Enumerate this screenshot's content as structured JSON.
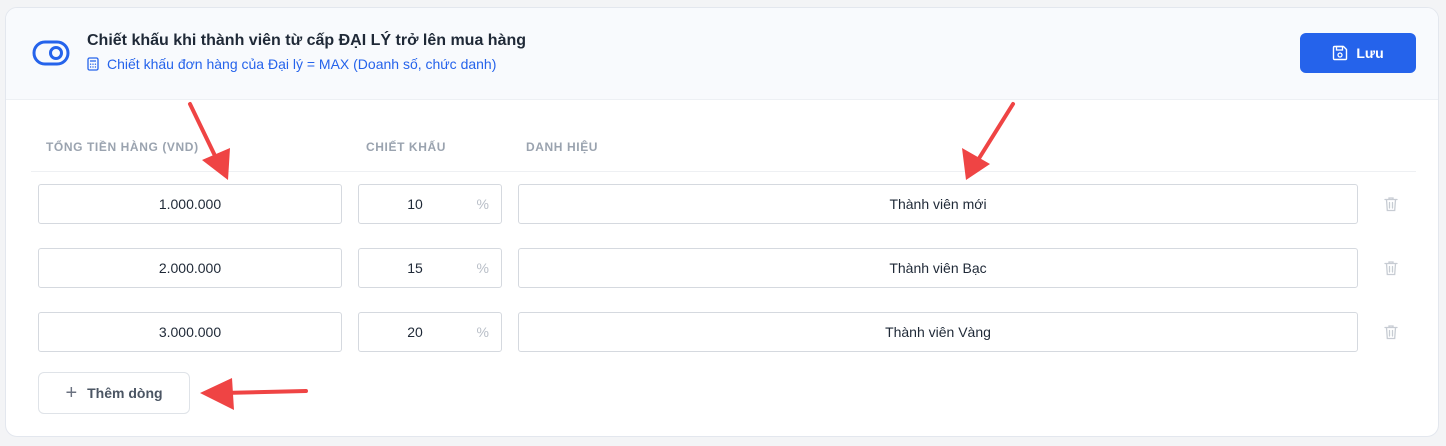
{
  "header": {
    "title": "Chiết khấu khi thành viên từ cấp ĐẠI LÝ trở lên mua hàng",
    "subtitle": "Chiết khấu đơn hàng của Đại lý = MAX (Doanh số, chức danh)",
    "save_label": "Lưu",
    "toggle_icon": "toggle-on-icon",
    "subtitle_icon": "calculator-icon",
    "save_icon": "floppy-disk-icon"
  },
  "table": {
    "columns": [
      "TỔNG TIỀN HÀNG (VND)",
      "CHIẾT KHẤU",
      "DANH HIỆU"
    ],
    "percent_sign": "%",
    "rows": [
      {
        "amount": "1.000.000",
        "discount": "10",
        "title": "Thành viên mới"
      },
      {
        "amount": "2.000.000",
        "discount": "15",
        "title": "Thành viên Bạc"
      },
      {
        "amount": "3.000.000",
        "discount": "20",
        "title": "Thành viên Vàng"
      }
    ]
  },
  "add_row_label": "Thêm dòng",
  "colors": {
    "accent": "#2563eb",
    "annotation_arrow": "#ef4444"
  }
}
